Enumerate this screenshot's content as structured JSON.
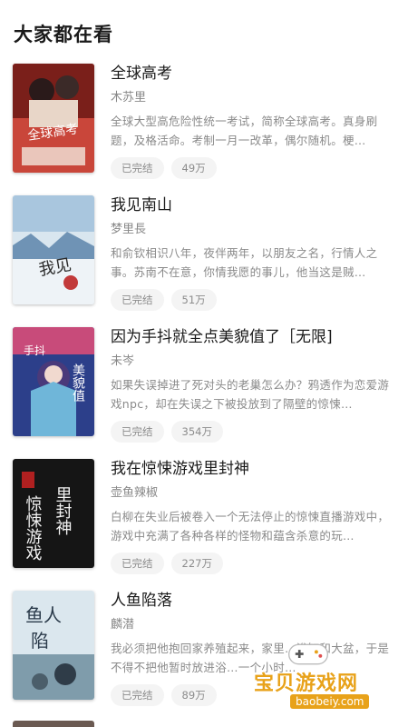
{
  "section": {
    "title": "大家都在看"
  },
  "books": [
    {
      "title": "全球高考",
      "author": "木苏里",
      "desc": "全球大型高危险性统一考试，简称全球高考。真身刷题，及格活命。考制一月一改革，偶尔随机。梗…",
      "status": "已完结",
      "count": "49万",
      "cover_icon": "book-cover-image"
    },
    {
      "title": "我见南山",
      "author": "梦里長",
      "desc": "和俞钦相识八年，夜伴两年，以朋友之名，行情人之事。苏南不在意，你情我愿的事儿，他当这是贼…",
      "status": "已完结",
      "count": "51万",
      "cover_icon": "book-cover-image"
    },
    {
      "title": "因为手抖就全点美貌值了［无限]",
      "author": "未岑",
      "desc": "如果失误掉进了死对头的老巢怎么办？鸦透作为恋爱游戏npc，却在失误之下被投放到了隔壁的惊悚…",
      "status": "已完结",
      "count": "354万",
      "cover_icon": "book-cover-image"
    },
    {
      "title": "我在惊悚游戏里封神",
      "author": "壶鱼辣椒",
      "desc": "白柳在失业后被卷入一个无法停止的惊悚直播游戏中，游戏中充满了各种各样的怪物和蕴含杀意的玩…",
      "status": "已完结",
      "count": "227万",
      "cover_icon": "book-cover-image"
    },
    {
      "title": "人鱼陷落",
      "author": "麟潜",
      "desc": "我必须把他抱回家养殖起来，家里…浴缸和大盆，于是不得不把他暂时放进浴…一个小时…",
      "status": "已完结",
      "count": "89万",
      "cover_icon": "book-cover-image"
    }
  ],
  "next_book": {
    "title": "…"
  },
  "watermark": {
    "name": "宝贝游戏网",
    "url": "baobeiy.com"
  },
  "colors": {
    "tag_bg": "#f4f4f4",
    "watermark": "#e8a21a"
  }
}
